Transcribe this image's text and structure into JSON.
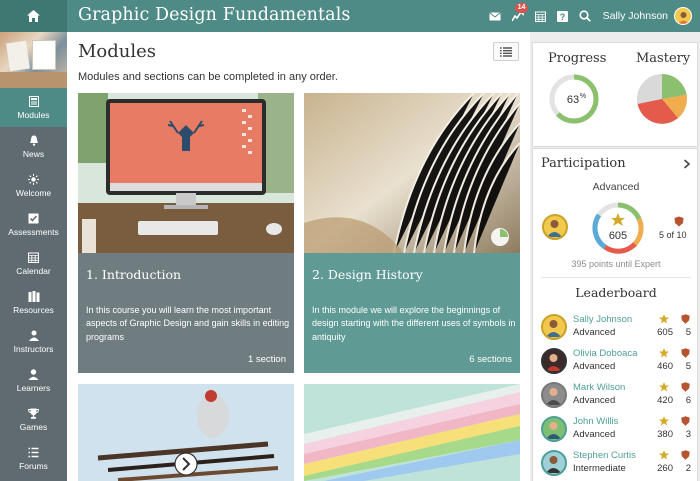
{
  "header": {
    "title": "Graphic Design Fundamentals",
    "notification_count": "14",
    "user_name": "Sally Johnson",
    "icons": [
      "home-icon",
      "mail-icon",
      "notifications-icon",
      "calendar-icon",
      "help-icon",
      "search-icon"
    ]
  },
  "sidebar": {
    "items": [
      {
        "label": "Modules",
        "icon": "modules-icon",
        "active": true
      },
      {
        "label": "News",
        "icon": "bell-icon"
      },
      {
        "label": "Welcome",
        "icon": "sun-icon"
      },
      {
        "label": "Assessments",
        "icon": "checkbox-icon"
      },
      {
        "label": "Calendar",
        "icon": "calendar-icon"
      },
      {
        "label": "Resources",
        "icon": "books-icon"
      },
      {
        "label": "Instructors",
        "icon": "instructor-icon"
      },
      {
        "label": "Learners",
        "icon": "person-icon"
      },
      {
        "label": "Games",
        "icon": "trophy-icon"
      },
      {
        "label": "Forums",
        "icon": "forums-icon"
      }
    ]
  },
  "main": {
    "title": "Modules",
    "subtitle": "Modules and sections can be completed in any order.",
    "cards": [
      {
        "title": "1. Introduction",
        "description": "In this course you will learn the most important aspects of Graphic Design and gain skills in editing programs",
        "count": "1 section"
      },
      {
        "title": "2. Design History",
        "description": "In this module we will explore the beginnings of design starting with the different uses of symbols in antiquity",
        "count": "6 sections"
      }
    ]
  },
  "right": {
    "progress_label": "Progress",
    "progress_value": "63",
    "progress_unit": "%",
    "progress_fraction": 0.63,
    "mastery_label": "Mastery",
    "participation_label": "Participation",
    "participation_level": "Advanced",
    "participation_points": "605",
    "badge_progress": "5 of 10",
    "points_until": "395 points until Expert",
    "leaderboard_label": "Leaderboard",
    "leaderboard": [
      {
        "name": "Sally Johnson",
        "level": "Advanced",
        "points": "605",
        "badges": "5"
      },
      {
        "name": "Olivia Doboaca",
        "level": "Advanced",
        "points": "460",
        "badges": "5"
      },
      {
        "name": "Mark Wilson",
        "level": "Advanced",
        "points": "420",
        "badges": "6"
      },
      {
        "name": "John Willis",
        "level": "Advanced",
        "points": "380",
        "badges": "3"
      },
      {
        "name": "Stephen Curtis",
        "level": "Intermediate",
        "points": "260",
        "badges": "2"
      }
    ]
  },
  "colors": {
    "header": "#4e8b86",
    "sidebar": "#5f6b70",
    "accent": "#4e9f97",
    "progress": "#8bc06e",
    "mastery_green": "#8bc06e",
    "mastery_orange": "#f0ad4e",
    "mastery_red": "#e55b4b",
    "mastery_gray": "#d9d9d9"
  }
}
